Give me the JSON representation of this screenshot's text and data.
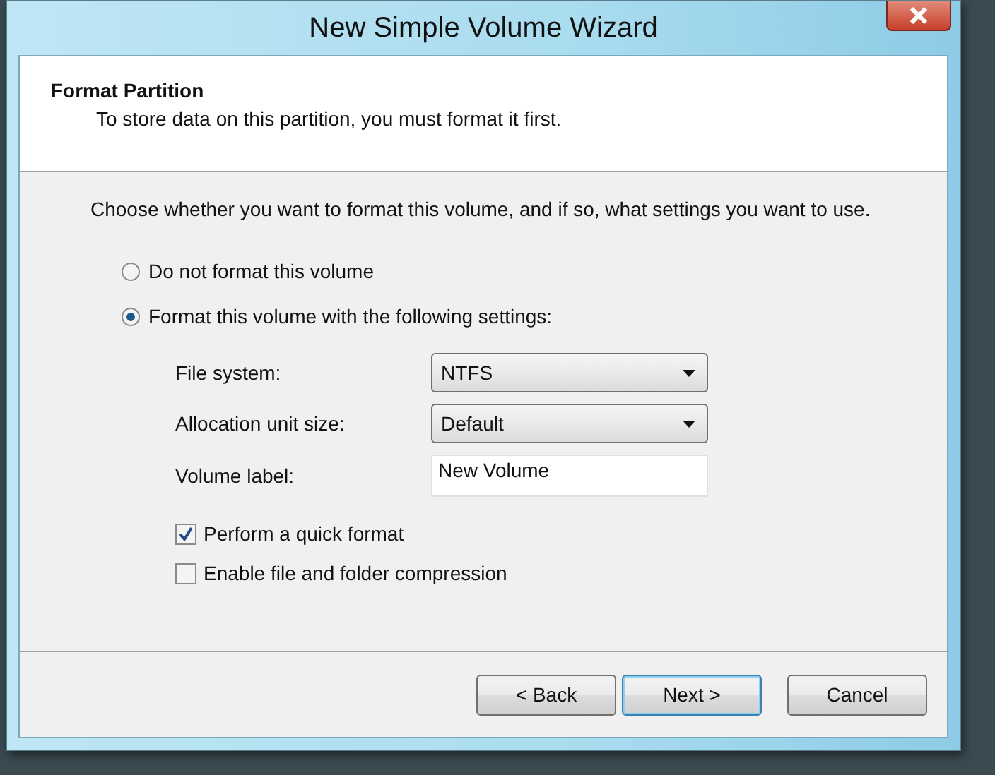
{
  "window": {
    "title": "New Simple Volume Wizard"
  },
  "header": {
    "title": "Format Partition",
    "subtitle": "To store data on this partition, you must format it first."
  },
  "instruction": "Choose whether you want to format this volume, and if so, what settings you want to use.",
  "options": [
    {
      "label": "Do not format this volume",
      "selected": false
    },
    {
      "label": "Format this volume with the following settings:",
      "selected": true
    }
  ],
  "settings": [
    {
      "kind": "dropdown",
      "label": "File system:",
      "value": "NTFS"
    },
    {
      "kind": "dropdown",
      "label": "Allocation unit size:",
      "value": "Default"
    },
    {
      "kind": "text",
      "label": "Volume label:",
      "value": "New Volume"
    }
  ],
  "checkboxes": [
    {
      "label": "Perform a quick format",
      "checked": true
    },
    {
      "label": "Enable file and folder compression",
      "checked": false
    }
  ],
  "buttons": [
    {
      "label": "< Back",
      "focused": false
    },
    {
      "label": "Next >",
      "focused": true
    },
    {
      "label": "Cancel",
      "focused": false
    }
  ]
}
